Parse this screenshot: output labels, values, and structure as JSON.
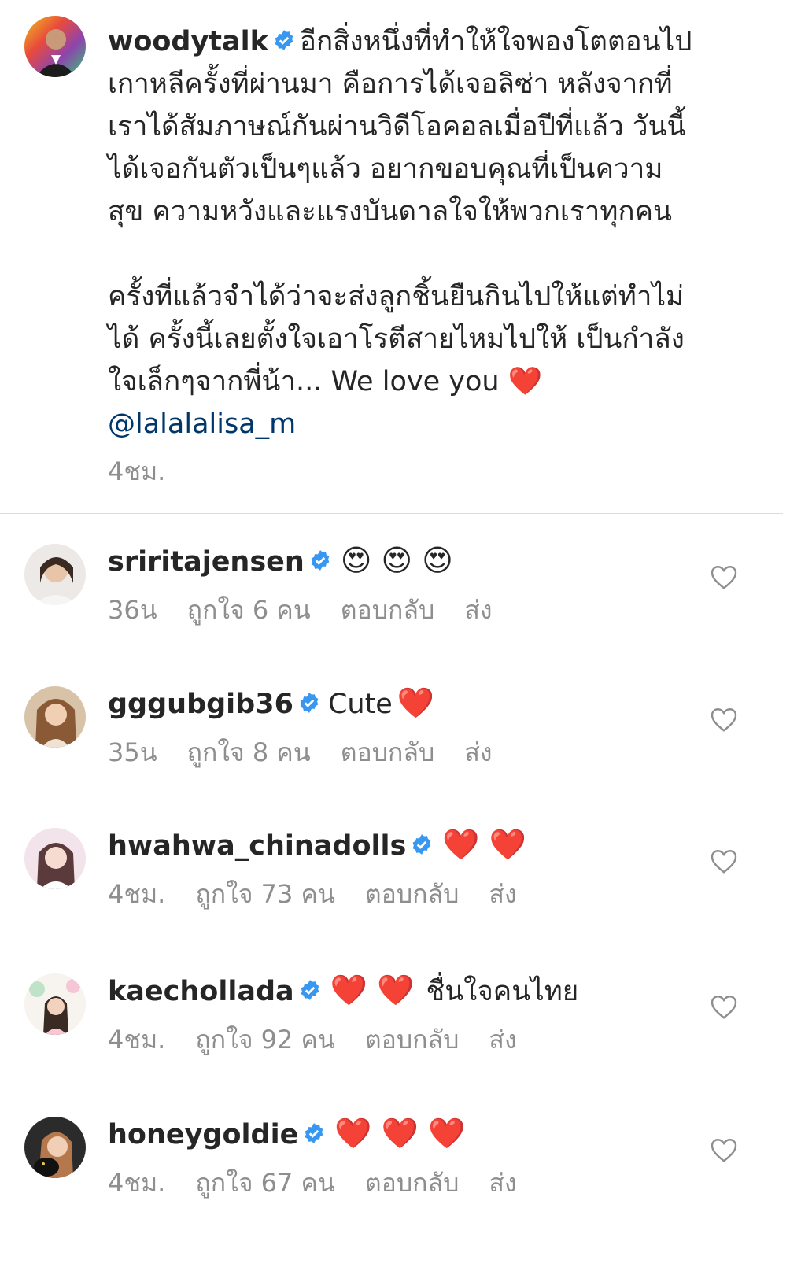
{
  "post": {
    "username": "woodytalk",
    "caption_lines": [
      "อีกสิ่งหนึ่งที่ทำให้ใจพองโตตอนไป",
      "เกาหลีครั้งที่ผ่านมา คือการได้เจอลิซ่า หลังจากที่",
      "เราได้สัมภาษณ์กันผ่านวิดีโอคอลเมื่อปีที่แล้ว วันนี้",
      "ได้เจอกันตัวเป็นๆแล้ว อยากขอบคุณที่เป็นความ",
      "สุข ความหวังและแรงบันดาลใจให้พวกเราทุกคน",
      "",
      "ครั้งที่แล้วจำได้ว่าจะส่งลูกชิ้นยืนกินไปให้แต่ทำไม่",
      "ได้ ครั้งนี้เลยตั้งใจเอาโรตีสายไหมไปให้ เป็นกำลัง",
      "ใจเล็กๆจากพี่น้า... We love you ❤️"
    ],
    "mention": "@lalalalisa_m",
    "time": "4ชม."
  },
  "comments": [
    {
      "username": "sriritajensen",
      "text": "",
      "emoji": "😍 😍 😍",
      "time": "36น",
      "likes": "ถูกใจ 6 คน",
      "reply": "ตอบกลับ",
      "send": "ส่ง"
    },
    {
      "username": "gggubgib36",
      "text": "Cute",
      "emoji": "❤️",
      "time": "35น",
      "likes": "ถูกใจ 8 คน",
      "reply": "ตอบกลับ",
      "send": "ส่ง"
    },
    {
      "username": "hwahwa_chinadolls",
      "text": "",
      "emoji": "❤️ ❤️",
      "time": "4ชม.",
      "likes": "ถูกใจ 73 คน",
      "reply": "ตอบกลับ",
      "send": "ส่ง"
    },
    {
      "username": "kaechollada",
      "text": "ชื่นใจคนไทย",
      "emoji": "❤️ ❤️",
      "time": "4ชม.",
      "likes": "ถูกใจ 92 คน",
      "reply": "ตอบกลับ",
      "send": "ส่ง"
    },
    {
      "username": "honeygoldie",
      "text": "",
      "emoji": "❤️ ❤️ ❤️",
      "time": "4ชม.",
      "likes": "ถูกใจ 67 คน",
      "reply": "ตอบกลับ",
      "send": "ส่ง"
    }
  ],
  "colors": {
    "verified": "#3897f0",
    "mention": "#00376b",
    "meta": "#8e8e8e",
    "heart": "#e0112b"
  }
}
